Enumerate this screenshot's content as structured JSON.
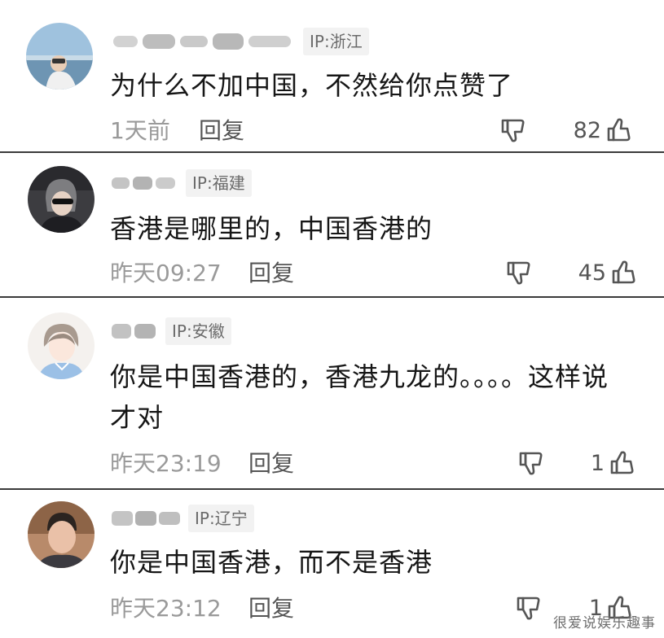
{
  "comments": [
    {
      "username": "",
      "ip": "IP:浙江",
      "text": "为什么不加中国，不然给你点赞了",
      "time": "1天前",
      "reply_label": "回复",
      "likes": "82",
      "avatar_icon": "avatar-photo-sea-icon"
    },
    {
      "username": "",
      "ip": "IP:福建",
      "text": "香港是哪里的，中国香港的",
      "time": "昨天09:27",
      "reply_label": "回复",
      "likes": "45",
      "avatar_icon": "avatar-photo-woman-icon"
    },
    {
      "username": "",
      "ip": "IP:安徽",
      "text": "你是中国香港的，香港九龙的。。。。这样说才对",
      "time": "昨天23:19",
      "reply_label": "回复",
      "likes": "1",
      "avatar_icon": "avatar-cartoon-boy-icon"
    },
    {
      "username": "",
      "ip": "IP:辽宁",
      "text": "你是中国香港，而不是香港",
      "time": "昨天23:12",
      "reply_label": "回复",
      "likes": "1",
      "avatar_icon": "avatar-photo-man-icon"
    }
  ],
  "icons": {
    "dislike": "thumbs-down-icon",
    "like": "thumbs-up-icon"
  },
  "watermark": "很爱说娱乐趣事",
  "colors": {
    "separator": "#3a3a3a",
    "meta_text": "#9a9a9a",
    "ip_badge_bg": "#f2f2f2"
  }
}
